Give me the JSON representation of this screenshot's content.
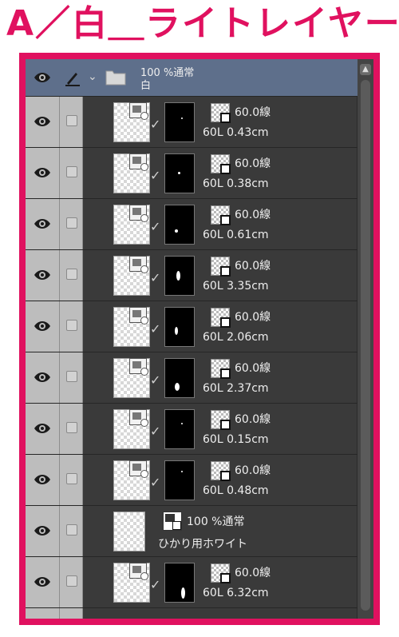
{
  "caption": "A／白＿ライトレイヤー",
  "folder": {
    "opacity_blend": "100 %通常",
    "name": "白"
  },
  "layers": [
    {
      "type": "line",
      "line": "60.0線",
      "brush": "60L 0.43cm"
    },
    {
      "type": "line",
      "line": "60.0線",
      "brush": "60L 0.38cm"
    },
    {
      "type": "line",
      "line": "60.0線",
      "brush": "60L 0.61cm"
    },
    {
      "type": "line",
      "line": "60.0線",
      "brush": "60L 3.35cm"
    },
    {
      "type": "line",
      "line": "60.0線",
      "brush": "60L 2.06cm"
    },
    {
      "type": "line",
      "line": "60.0線",
      "brush": "60L 2.37cm"
    },
    {
      "type": "line",
      "line": "60.0線",
      "brush": "60L 0.15cm"
    },
    {
      "type": "line",
      "line": "60.0線",
      "brush": "60L 0.48cm"
    },
    {
      "type": "raster",
      "opacity_blend": "100 %通常",
      "name": "ひかり用ホワイト"
    },
    {
      "type": "line",
      "line": "60.0線",
      "brush": "60L 6.32cm"
    }
  ],
  "colors": {
    "accent": "#e0115f",
    "panel": "#3a3a3a",
    "folder_selected": "#5e6f8b"
  },
  "icons": {
    "visibility": "eye-icon",
    "edit": "pen-icon",
    "lock": "lock-checkbox-icon",
    "folder": "folder-icon"
  }
}
